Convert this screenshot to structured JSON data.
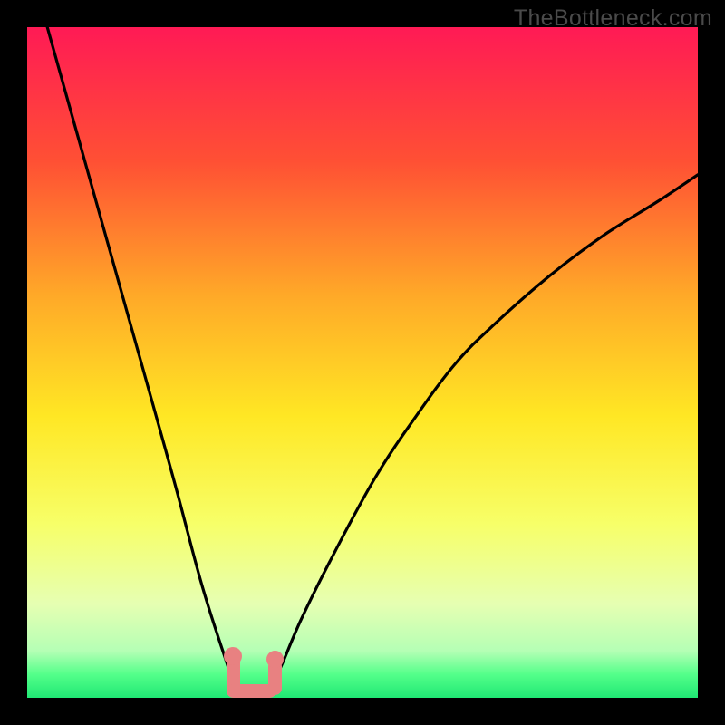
{
  "watermark": "TheBottleneck.com",
  "chart_data": {
    "type": "line",
    "title": "",
    "xlabel": "",
    "ylabel": "",
    "xlim": [
      0,
      100
    ],
    "ylim": [
      0,
      100
    ],
    "grid": false,
    "legend": false,
    "series": [
      {
        "name": "bottleneck-curve",
        "x": [
          3,
          10,
          17,
          22,
          26,
          29.5,
          31,
          32.5,
          34.5,
          36.5,
          38,
          41,
          46,
          52,
          58,
          64,
          70,
          78,
          86,
          94,
          100
        ],
        "values": [
          100,
          75,
          50,
          32,
          17,
          6,
          2,
          1,
          1,
          2,
          5,
          12,
          22,
          33,
          42,
          50,
          56,
          63,
          69,
          74,
          78
        ]
      }
    ],
    "annotations": [
      {
        "name": "pink-marker",
        "x_range": [
          30.5,
          37.5
        ],
        "y_range": [
          1.5,
          6
        ],
        "color": "#e88181"
      }
    ],
    "background_gradient": {
      "stops": [
        {
          "offset": 0.0,
          "color": "#ff1a55"
        },
        {
          "offset": 0.2,
          "color": "#ff5034"
        },
        {
          "offset": 0.4,
          "color": "#ffa928"
        },
        {
          "offset": 0.58,
          "color": "#ffe724"
        },
        {
          "offset": 0.74,
          "color": "#f7ff68"
        },
        {
          "offset": 0.86,
          "color": "#e6ffb2"
        },
        {
          "offset": 0.93,
          "color": "#b5ffb5"
        },
        {
          "offset": 0.965,
          "color": "#54ff8a"
        },
        {
          "offset": 1.0,
          "color": "#20e874"
        }
      ]
    }
  }
}
